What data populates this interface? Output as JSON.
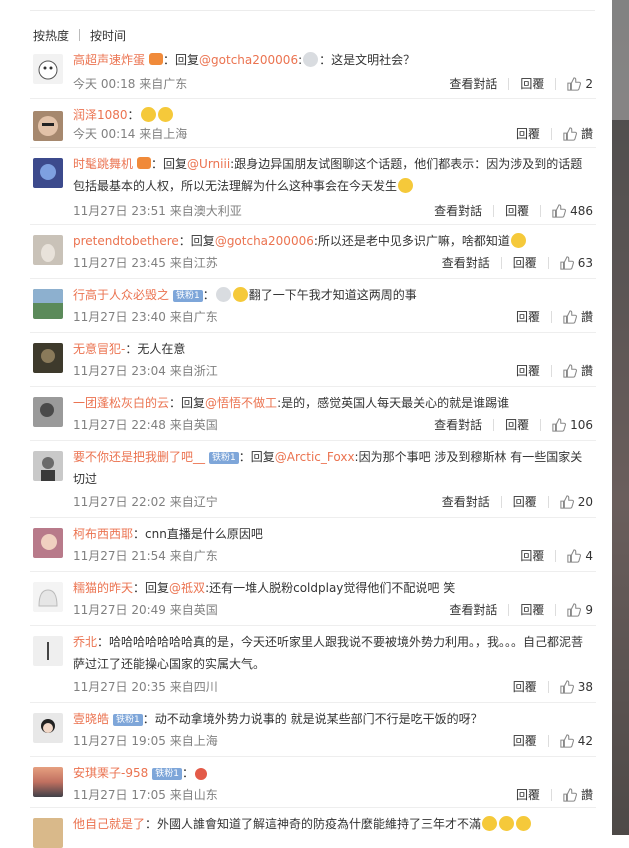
{
  "sort": {
    "hot": "按热度",
    "time": "按时间"
  },
  "labels": {
    "view_conv": "查看對話",
    "reply": "回覆",
    "like": "讚",
    "reply_prefix": "回复",
    "from": "来自"
  },
  "comments": [
    {
      "user": "高超声速炸蛋",
      "mention": "@gotcha200006",
      "body": "：这是文明社会？",
      "time": "今天 00:18",
      "loc": "广东",
      "likes": "2"
    },
    {
      "user": "润泽1080",
      "body": "：",
      "time": "今天 00:14",
      "loc": "上海",
      "likes": "讚"
    },
    {
      "user": "时髦跳舞机",
      "mention": "@Urniii",
      "body": ":跟身边异国朋友试图聊这个话题，他们都表示：因为涉及到的话题包括最基本的人权，所以无法理解为什么这种事会在今天发生",
      "time": "11月27日 23:51",
      "loc": "澳大利亚",
      "likes": "486"
    },
    {
      "user": "pretendtobethere",
      "mention": "@gotcha200006",
      "body": ":所以还是老中见多识广嘛，啥都知道",
      "time": "11月27日 23:45",
      "loc": "江苏",
      "likes": "63"
    },
    {
      "user": "行高于人众必毁之",
      "badge": "铁粉1",
      "body": "翻了一下午我才知道这两周的事",
      "time": "11月27日 23:40",
      "loc": "广东",
      "likes": "讚"
    },
    {
      "user": "无意冒犯-",
      "body": "：无人在意",
      "time": "11月27日 23:04",
      "loc": "浙江",
      "likes": "讚"
    },
    {
      "user": "一团蓬松灰白的云",
      "mention": "@悟悟不做工",
      "body": ":是的，感觉英国人每天最关心的就是谁踢谁",
      "time": "11月27日 22:48",
      "loc": "英国",
      "likes": "106"
    },
    {
      "user": "要不你还是把我删了吧__",
      "badge": "铁粉1",
      "mention": "@Arctic_Foxx",
      "body": ":因为那个事吧 涉及到穆斯林 有一些国家关切过",
      "time": "11月27日 22:02",
      "loc": "辽宁",
      "likes": "20"
    },
    {
      "user": "柯布西西耶",
      "body": "：cnn直播是什么原因吧",
      "time": "11月27日 21:54",
      "loc": "广东",
      "likes": "4"
    },
    {
      "user": "糯猫的昨天",
      "mention": "@祗双",
      "body": ":还有一堆人脱粉coldplay觉得他们不配说吧 笑",
      "time": "11月27日 20:49",
      "loc": "英国",
      "likes": "9"
    },
    {
      "user": "乔北",
      "body": "：哈哈哈哈哈哈哈真的是，今天还听家里人跟我说不要被境外势力利用。，我。。。自己都泥菩萨过江了还能操心国家的实属大气。",
      "time": "11月27日 20:35",
      "loc": "四川",
      "likes": "38"
    },
    {
      "user": "壹晓皓",
      "badge": "铁粉1",
      "body": "：动不动拿境外势力说事的 就是说某些部门不行是吃干饭的呀？",
      "time": "11月27日 19:05",
      "loc": "上海",
      "likes": "42"
    },
    {
      "user": "安琪栗子-958",
      "badge": "铁粉1",
      "body": "：",
      "time": "11月27日 17:05",
      "loc": "山东",
      "likes": "讚"
    },
    {
      "user": "他自己就是了",
      "body": "：外國人誰會知道了解這神奇的防疫為什麼能維持了三年才不滿",
      "time": "",
      "loc": "",
      "likes": ""
    }
  ],
  "colors": {
    "accent": "#eb7350",
    "meta": "#808080"
  }
}
